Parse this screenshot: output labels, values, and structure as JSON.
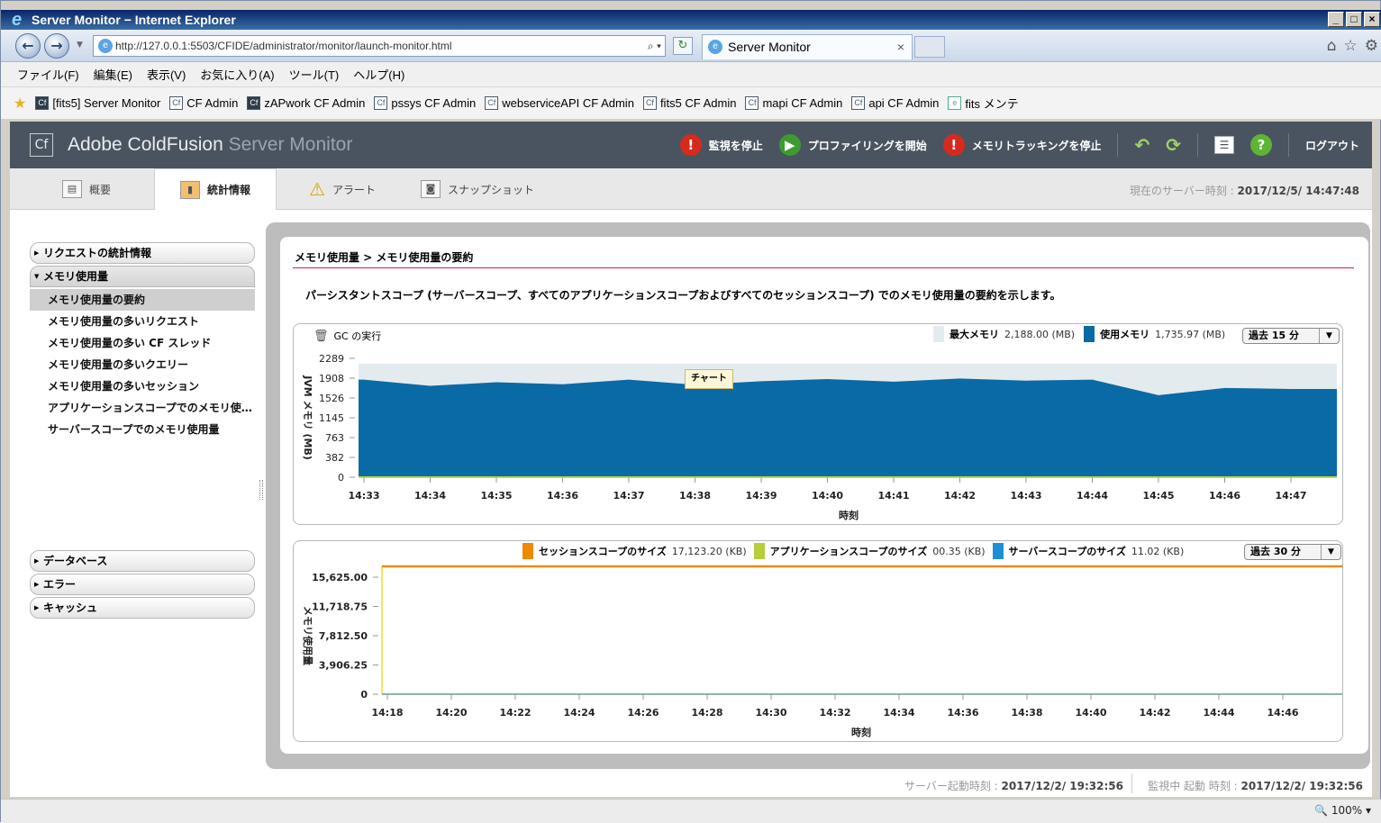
{
  "browser": {
    "title": "Server Monitor − Internet Explorer",
    "url": "http://127.0.0.1:5503/CFIDE/administrator/monitor/launch-monitor.html",
    "tab_label": "Server Monitor",
    "menu": [
      "ファイル(F)",
      "編集(E)",
      "表示(V)",
      "お気に入り(A)",
      "ツール(T)",
      "ヘルプ(H)"
    ],
    "favorites": [
      {
        "label": "[fits5] Server Monitor",
        "icon": "cf-dark"
      },
      {
        "label": "CF Admin",
        "icon": "cf"
      },
      {
        "label": "zAPwork CF Admin",
        "icon": "cf-dark"
      },
      {
        "label": "pssys CF Admin",
        "icon": "cf"
      },
      {
        "label": "webserviceAPI CF Admin",
        "icon": "cf"
      },
      {
        "label": "fits5 CF Admin",
        "icon": "cf"
      },
      {
        "label": "mapi CF Admin",
        "icon": "cf"
      },
      {
        "label": "api CF Admin",
        "icon": "cf"
      },
      {
        "label": "fits メンテ",
        "icon": "page"
      }
    ],
    "zoom": "100%"
  },
  "app": {
    "name": "Adobe ColdFusion",
    "name_suffix": " Server Monitor",
    "actions": {
      "stop_monitor": "監視を停止",
      "start_profiling": "プロファイリングを開始",
      "stop_memory_tracking": "メモリトラッキングを停止",
      "logout": "ログアウト"
    },
    "tabs": [
      "概要",
      "統計情報",
      "アラート",
      "スナップショット"
    ],
    "server_time_label": "現在のサーバー時刻 : ",
    "server_time": "2017/12/5/  14:47:48"
  },
  "sidebar": {
    "sections": [
      {
        "label": "リクエストの統計情報",
        "open": false
      },
      {
        "label": "メモリ使用量",
        "open": true
      }
    ],
    "memory_items": [
      "メモリ使用量の要約",
      "メモリ使用量の多いリクエスト",
      "メモリ使用量の多い CF スレッド",
      "メモリ使用量の多いクエリー",
      "メモリ使用量の多いセッション",
      "アプリケーションスコープでのメモリ使…",
      "サーバースコープでのメモリ使用量"
    ],
    "bottom_sections": [
      "データベース",
      "エラー",
      "キャッシュ"
    ]
  },
  "main": {
    "breadcrumb": "メモリ使用量 > メモリ使用量の要約",
    "description": "パーシスタントスコープ (サーバースコープ、すべてのアプリケーションスコープおよびすべてのセッションスコープ) でのメモリ使用量の要約を示します。",
    "tooltip": "チャート"
  },
  "chart_data": [
    {
      "type": "area",
      "gc_label": "GC の実行",
      "ylabel": "JVM メモリ (MB)",
      "xlabel": "時刻",
      "ylim": [
        0,
        2289
      ],
      "yticks": [
        "2289",
        "1908",
        "1526",
        "1145",
        "763",
        "382",
        "0"
      ],
      "categories": [
        "14:33",
        "14:34",
        "14:35",
        "14:36",
        "14:37",
        "14:38",
        "14:39",
        "14:40",
        "14:41",
        "14:42",
        "14:43",
        "14:44",
        "14:45",
        "14:46",
        "14:47"
      ],
      "range_select": "過去 15 分",
      "legend": [
        {
          "name": "最大メモリ",
          "value": "2,188.00 (MB)",
          "color": "#e4ebef"
        },
        {
          "name": "使用メモリ",
          "value": "1,735.97 (MB)",
          "color": "#0a6aa6"
        }
      ],
      "series": [
        {
          "name": "最大メモリ",
          "values": [
            2188,
            2188,
            2188,
            2188,
            2188,
            2188,
            2188,
            2188,
            2188,
            2188,
            2188,
            2188,
            2188,
            2188,
            2188
          ]
        },
        {
          "name": "使用メモリ",
          "values": [
            1880,
            1760,
            1830,
            1790,
            1880,
            1780,
            1850,
            1890,
            1840,
            1900,
            1860,
            1880,
            1580,
            1720,
            1700
          ]
        }
      ]
    },
    {
      "type": "line",
      "ylabel": "メモリ使用量",
      "xlabel": "時刻",
      "ylim": [
        0,
        15625
      ],
      "yticks": [
        "15,625.00",
        "11,718.75",
        "7,812.50",
        "3,906.25",
        "0"
      ],
      "categories": [
        "14:18",
        "14:20",
        "14:22",
        "14:24",
        "14:26",
        "14:28",
        "14:30",
        "14:32",
        "14:34",
        "14:36",
        "14:38",
        "14:40",
        "14:42",
        "14:44",
        "14:46"
      ],
      "range_select": "過去 30 分",
      "legend": [
        {
          "name": "セッションスコープのサイズ",
          "value": "17,123.20 (KB)",
          "color": "#f08a00"
        },
        {
          "name": "アプリケーションスコープのサイズ",
          "value": "00.35 (KB)",
          "color": "#b8cc3c"
        },
        {
          "name": "サーバースコープのサイズ",
          "value": "11.02 (KB)",
          "color": "#1e8fd6"
        }
      ],
      "series": [
        {
          "name": "セッションスコープのサイズ",
          "values": [
            17123.2,
            17123.2,
            17123.2,
            17123.2,
            17123.2,
            17123.2,
            17123.2,
            17123.2,
            17123.2,
            17123.2,
            17123.2,
            17123.2,
            17123.2,
            17123.2,
            17123.2
          ]
        },
        {
          "name": "アプリケーションスコープのサイズ",
          "values": [
            0.35,
            0.35,
            0.35,
            0.35,
            0.35,
            0.35,
            0.35,
            0.35,
            0.35,
            0.35,
            0.35,
            0.35,
            0.35,
            0.35,
            0.35
          ]
        },
        {
          "name": "サーバースコープのサイズ",
          "values": [
            11.02,
            11.02,
            11.02,
            11.02,
            11.02,
            11.02,
            11.02,
            11.02,
            11.02,
            11.02,
            11.02,
            11.02,
            11.02,
            11.02,
            11.02
          ]
        }
      ]
    }
  ],
  "footer": {
    "server_start_label": "サーバー起動時刻 : ",
    "server_start": "2017/12/2/  19:32:56",
    "monitor_start_label": "監視中 起動 時刻 : ",
    "monitor_start": "2017/12/2/  19:32:56"
  }
}
